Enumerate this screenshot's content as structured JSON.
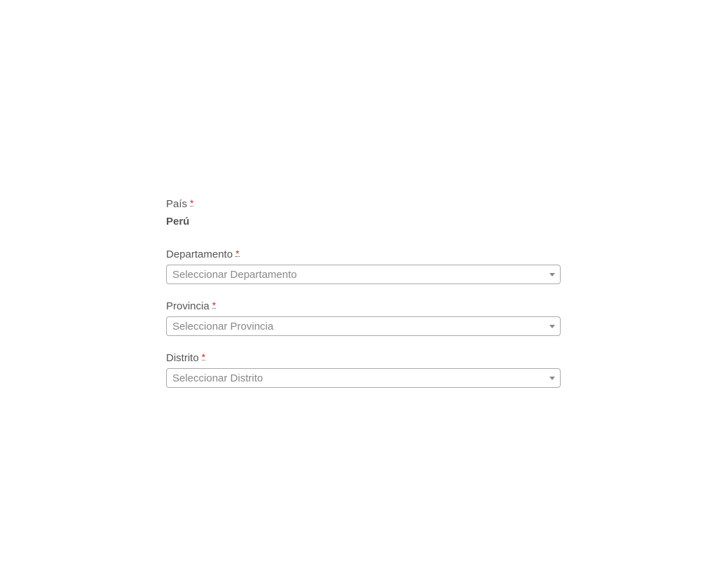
{
  "form": {
    "country": {
      "label": "País",
      "required_mark": "*",
      "value": "Perú"
    },
    "department": {
      "label": "Departamento",
      "required_mark": "*",
      "placeholder": "Seleccionar Departamento"
    },
    "province": {
      "label": "Provincia",
      "required_mark": "*",
      "placeholder": "Seleccionar Provincia"
    },
    "district": {
      "label": "Distrito",
      "required_mark": "*",
      "placeholder": "Seleccionar Distrito"
    }
  },
  "colors": {
    "required": "#d9262c",
    "label": "#555555",
    "placeholder": "#888888",
    "border": "#aaaaaa"
  }
}
